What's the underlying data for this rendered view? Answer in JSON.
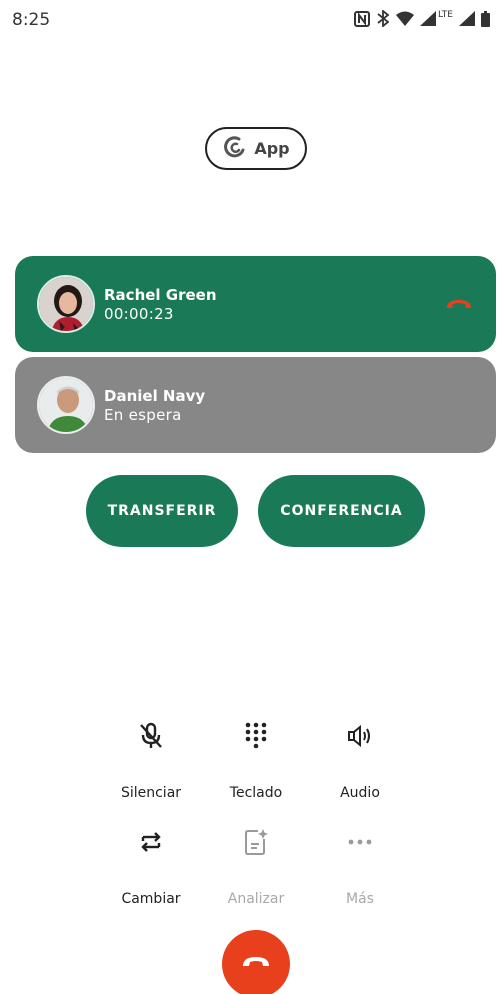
{
  "status_bar": {
    "time": "8:25",
    "network_label": "LTE"
  },
  "app_badge": {
    "label": "App"
  },
  "calls": [
    {
      "name": "Rachel Green",
      "status": "00:00:23"
    },
    {
      "name": "Daniel Navy",
      "status": "En espera"
    }
  ],
  "actions": {
    "transfer": "TRANSFERIR",
    "conference": "CONFERENCIA"
  },
  "controls": {
    "mute": "Silenciar",
    "keypad": "Teclado",
    "audio": "Audio",
    "swap": "Cambiar",
    "analyze": "Analizar",
    "more": "Más"
  },
  "colors": {
    "active_call": "#1a7a57",
    "held_call": "#878787",
    "end_call": "#e8401c",
    "disabled_text": "#a8a8a8"
  }
}
